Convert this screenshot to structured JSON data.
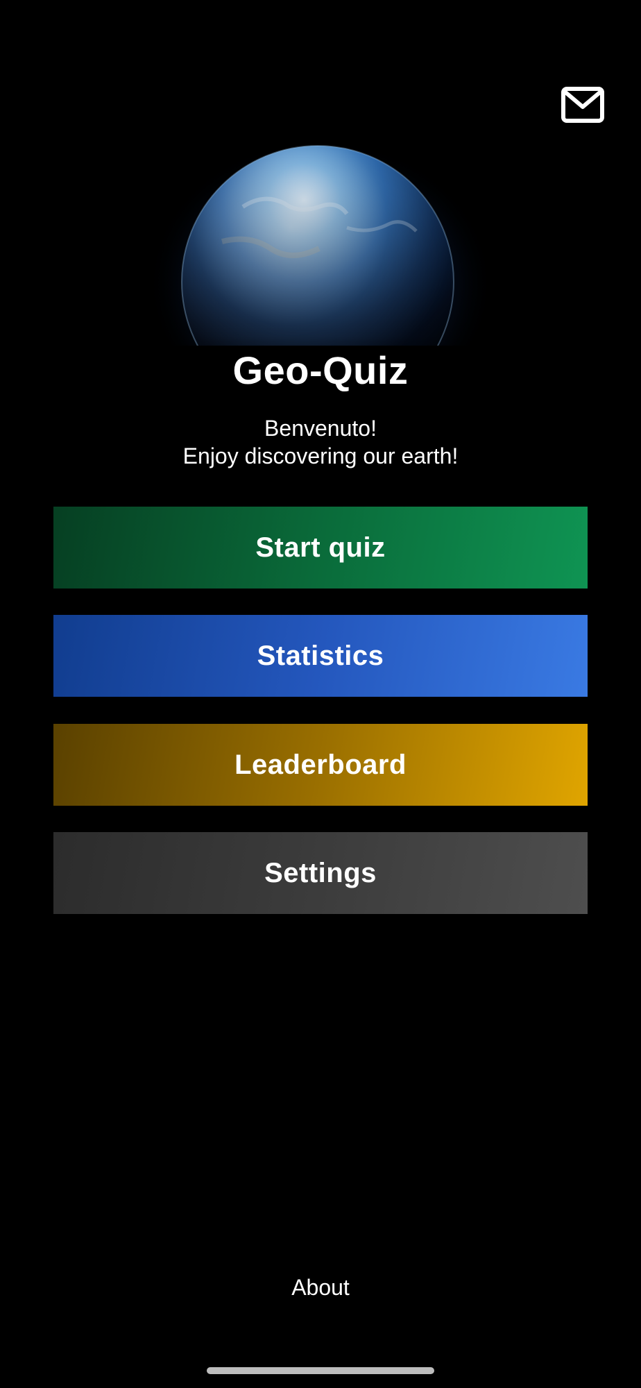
{
  "app": {
    "title": "Geo-Quiz",
    "welcome": "Benvenuto!",
    "tagline": "Enjoy discovering our earth!"
  },
  "header": {
    "mail_icon": "mail-icon"
  },
  "hero": {
    "image": "earth-globe"
  },
  "menu": {
    "start": "Start quiz",
    "statistics": "Statistics",
    "leaderboard": "Leaderboard",
    "settings": "Settings"
  },
  "footer": {
    "about": "About"
  },
  "colors": {
    "background": "#000000",
    "start_quiz": "#0f9453",
    "statistics": "#3a7ae3",
    "leaderboard": "#e0a500",
    "settings": "#4e4e4e"
  }
}
